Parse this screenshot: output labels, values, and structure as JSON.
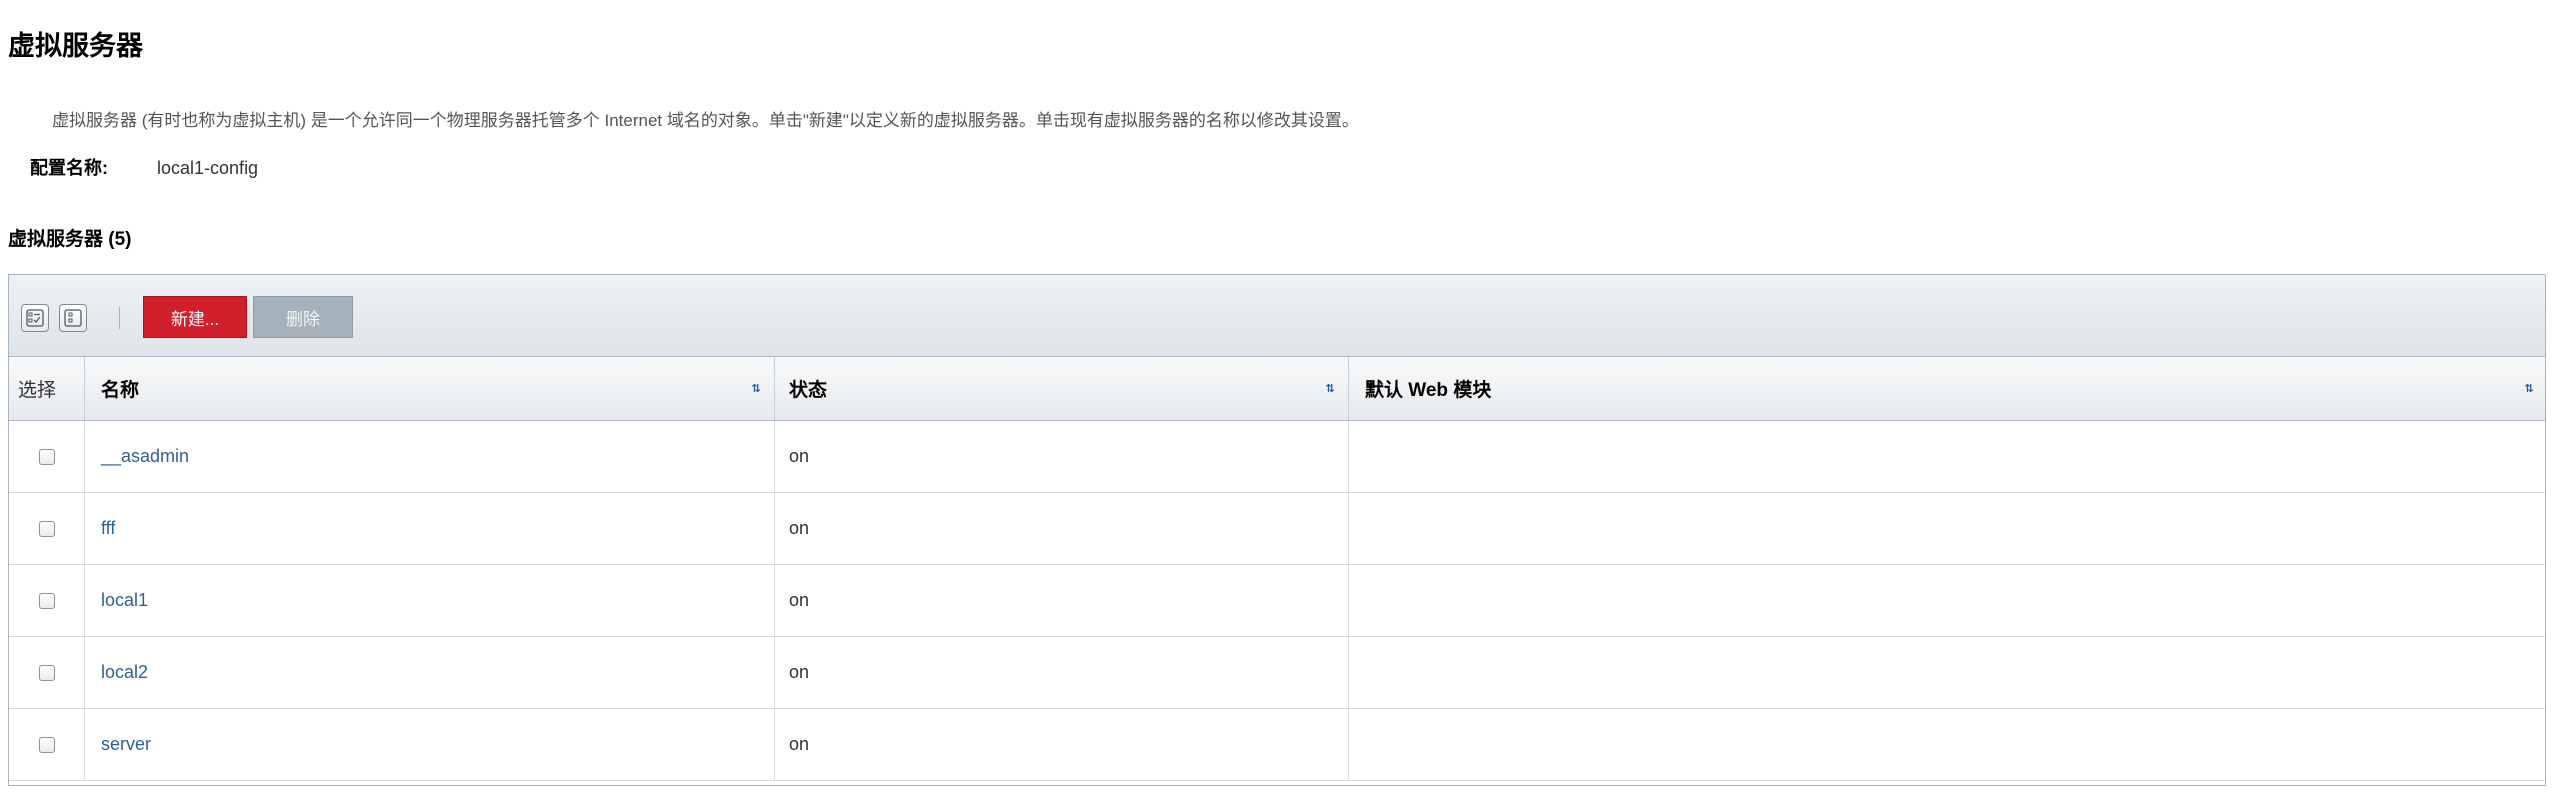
{
  "page": {
    "title": "虚拟服务器",
    "help_text": "虚拟服务器 (有时也称为虚拟主机) 是一个允许同一个物理服务器托管多个 Internet 域名的对象。单击\"新建\"以定义新的虚拟服务器。单击现有虚拟服务器的名称以修改其设置。",
    "config_label": "配置名称:",
    "config_value": "local1-config"
  },
  "table": {
    "title": "虚拟服务器 (5)",
    "toolbar": {
      "select_all_icon": "select-all-icon",
      "deselect_all_icon": "deselect-all-icon",
      "new_label": "新建...",
      "delete_label": "删除",
      "colors": {
        "new_button": "#d21f2c",
        "delete_button": "#a5b2bb"
      }
    },
    "headers": {
      "select": "选择",
      "name": "名称",
      "state": "状态",
      "default_web_module": "默认 Web 模块"
    },
    "rows": [
      {
        "name": "__asadmin",
        "state": "on",
        "default_web_module": ""
      },
      {
        "name": "fff",
        "state": "on",
        "default_web_module": ""
      },
      {
        "name": "local1",
        "state": "on",
        "default_web_module": ""
      },
      {
        "name": "local2",
        "state": "on",
        "default_web_module": ""
      },
      {
        "name": "server",
        "state": "on",
        "default_web_module": ""
      }
    ]
  }
}
